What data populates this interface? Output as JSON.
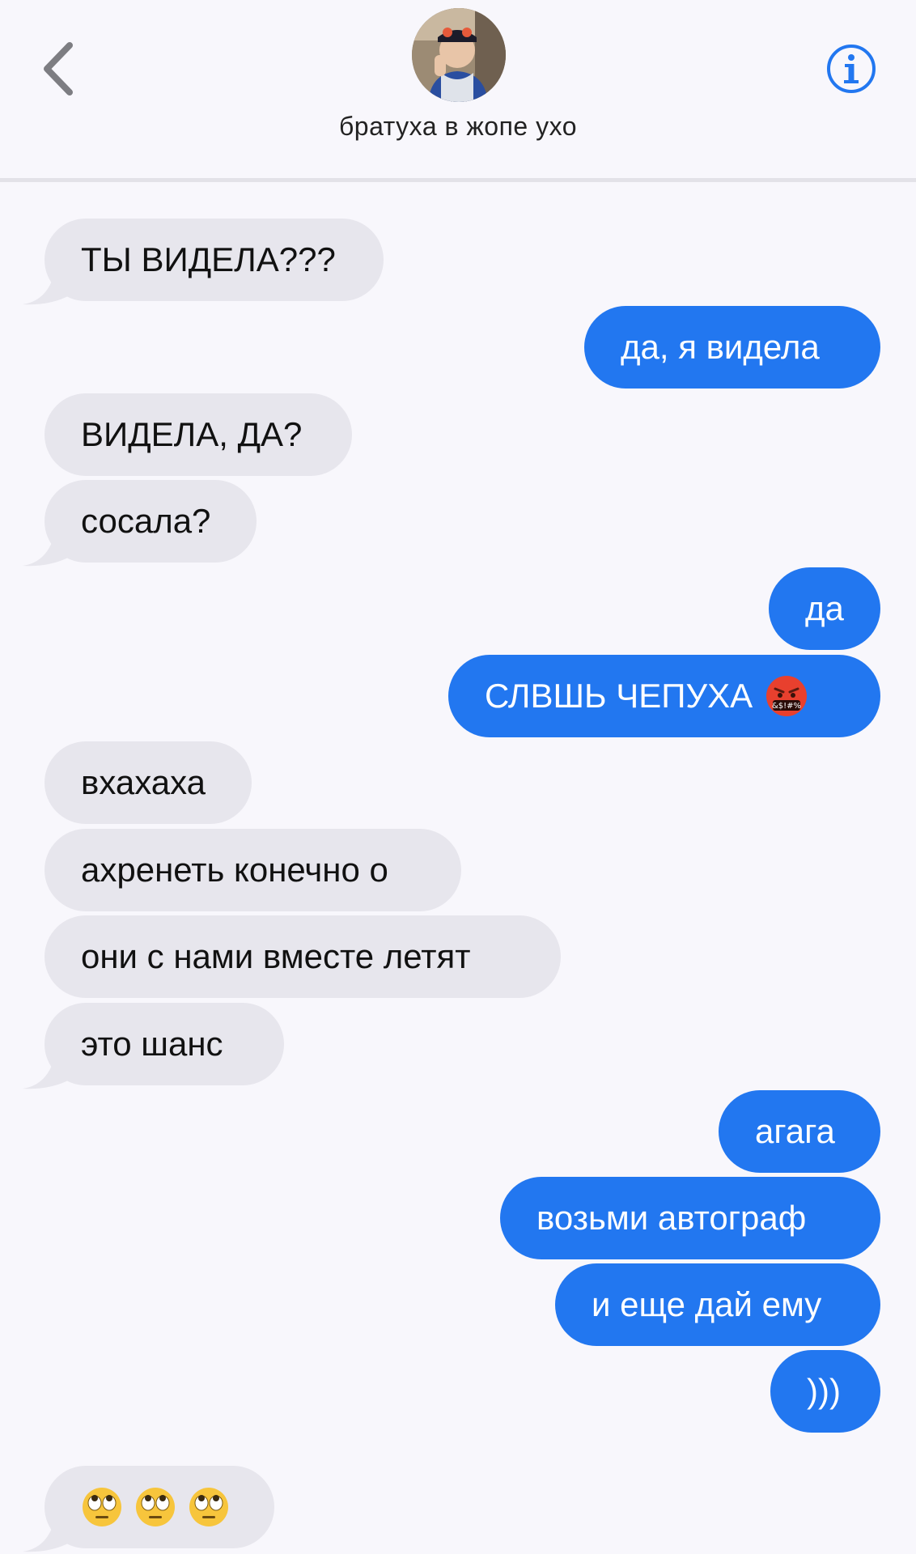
{
  "header": {
    "contact_name": "братуха в жопе ухо",
    "back_icon": "chevron-left-icon",
    "info_icon": "info-circle-icon"
  },
  "colors": {
    "outgoing_bubble": "#2277f0",
    "incoming_bubble": "#e7e6ed",
    "accent": "#2277f0",
    "background": "#f8f7fc"
  },
  "messages": [
    {
      "dir": "in",
      "text": "ТЫ ВИДЕЛА???"
    },
    {
      "dir": "out",
      "text": "да, я видела"
    },
    {
      "dir": "in",
      "text": "ВИДЕЛА, ДА?"
    },
    {
      "dir": "in",
      "text": "сосала?"
    },
    {
      "dir": "out",
      "text": "да"
    },
    {
      "dir": "out",
      "text": "СЛВШЬ ЧЕПУХА",
      "emoji": "face-with-symbols-on-mouth"
    },
    {
      "dir": "in",
      "text": "вхахаха"
    },
    {
      "dir": "in",
      "text": "ахренеть конечно о"
    },
    {
      "dir": "in",
      "text": "они с нами вместе летят"
    },
    {
      "dir": "in",
      "text": "это шанс"
    },
    {
      "dir": "out",
      "text": "агага"
    },
    {
      "dir": "out",
      "text": "возьми автограф"
    },
    {
      "dir": "out",
      "text": "и еще дай ему"
    },
    {
      "dir": "out",
      "text": ")))"
    },
    {
      "dir": "in",
      "text": "",
      "emoji": "face-with-rolling-eyes x3"
    }
  ]
}
